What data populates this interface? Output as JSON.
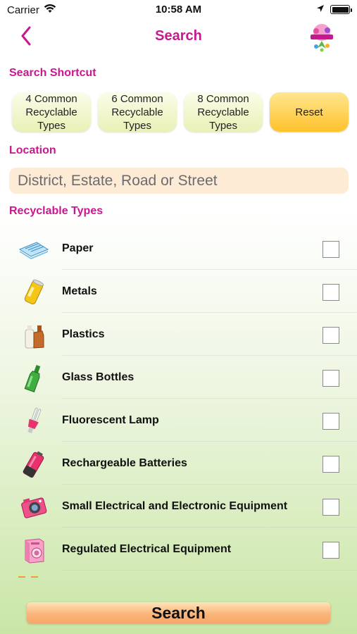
{
  "status_bar": {
    "carrier": "Carrier",
    "time": "10:58 AM"
  },
  "nav": {
    "title": "Search",
    "back_icon": "chevron-left-icon",
    "logo": "app-logo"
  },
  "shortcut": {
    "label": "Search Shortcut",
    "buttons": [
      "4 Common\nRecyclable\nTypes",
      "6 Common\nRecyclable\nTypes",
      "8 Common\nRecyclable\nTypes"
    ],
    "reset": "Reset"
  },
  "location": {
    "label": "Location",
    "placeholder": "District, Estate, Road or Street",
    "value": ""
  },
  "recyclable": {
    "label": "Recyclable Types",
    "items": [
      {
        "label": "Paper",
        "icon": "paper-icon",
        "checked": false
      },
      {
        "label": "Metals",
        "icon": "metal-can-icon",
        "checked": false
      },
      {
        "label": "Plastics",
        "icon": "plastic-bottle-icon",
        "checked": false
      },
      {
        "label": "Glass Bottles",
        "icon": "glass-bottle-icon",
        "checked": false
      },
      {
        "label": "Fluorescent Lamp",
        "icon": "fluorescent-lamp-icon",
        "checked": false
      },
      {
        "label": "Rechargeable Batteries",
        "icon": "battery-icon",
        "checked": false
      },
      {
        "label": "Small Electrical and Electronic Equipment",
        "icon": "camera-icon",
        "checked": false
      },
      {
        "label": "Regulated Electrical Equipment",
        "icon": "washing-machine-icon",
        "checked": false
      }
    ]
  },
  "search_button": "Search",
  "colors": {
    "accent": "#c8178f",
    "shortcut_button": "#e9f0b6",
    "reset_button": "#ffc22a",
    "search_button": "#f9b57a",
    "input_background": "#fdebd6"
  }
}
